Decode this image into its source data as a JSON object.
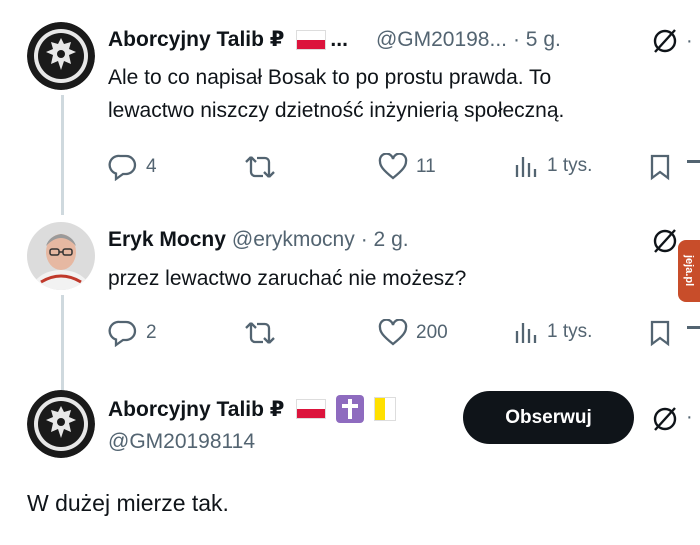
{
  "tweets": [
    {
      "display_name": "Aborcyjny Talib ₽",
      "badge_more": "...",
      "handle": "@GM20198...",
      "time": "· 5 g.",
      "text_line1": "Ale to co napisał Bosak to po prostu prawda. To",
      "text_line2": "lewactwo niszczy dzietność inżynierią społeczną.",
      "replies": "4",
      "likes": "11",
      "views": "1 tys."
    },
    {
      "display_name": "Eryk Mocny",
      "handle": "@erykmocny",
      "time": "· 2 g.",
      "text_line1": "przez lewactwo zaruchać nie możesz?",
      "replies": "2",
      "likes": "200",
      "views": "1 tys."
    }
  ],
  "main_tweet": {
    "display_name": "Aborcyjny Talib ₽",
    "handle": "@GM20198114",
    "follow_label": "Obserwuj",
    "text": "W dużej mierze tak."
  },
  "watermark": "jeja.pl",
  "colors": {
    "text": "#0f1419",
    "secondary": "#536471",
    "thread_line": "#cfd9de",
    "button_bg": "#0f1419",
    "watermark_bg": "#c84d2a"
  }
}
